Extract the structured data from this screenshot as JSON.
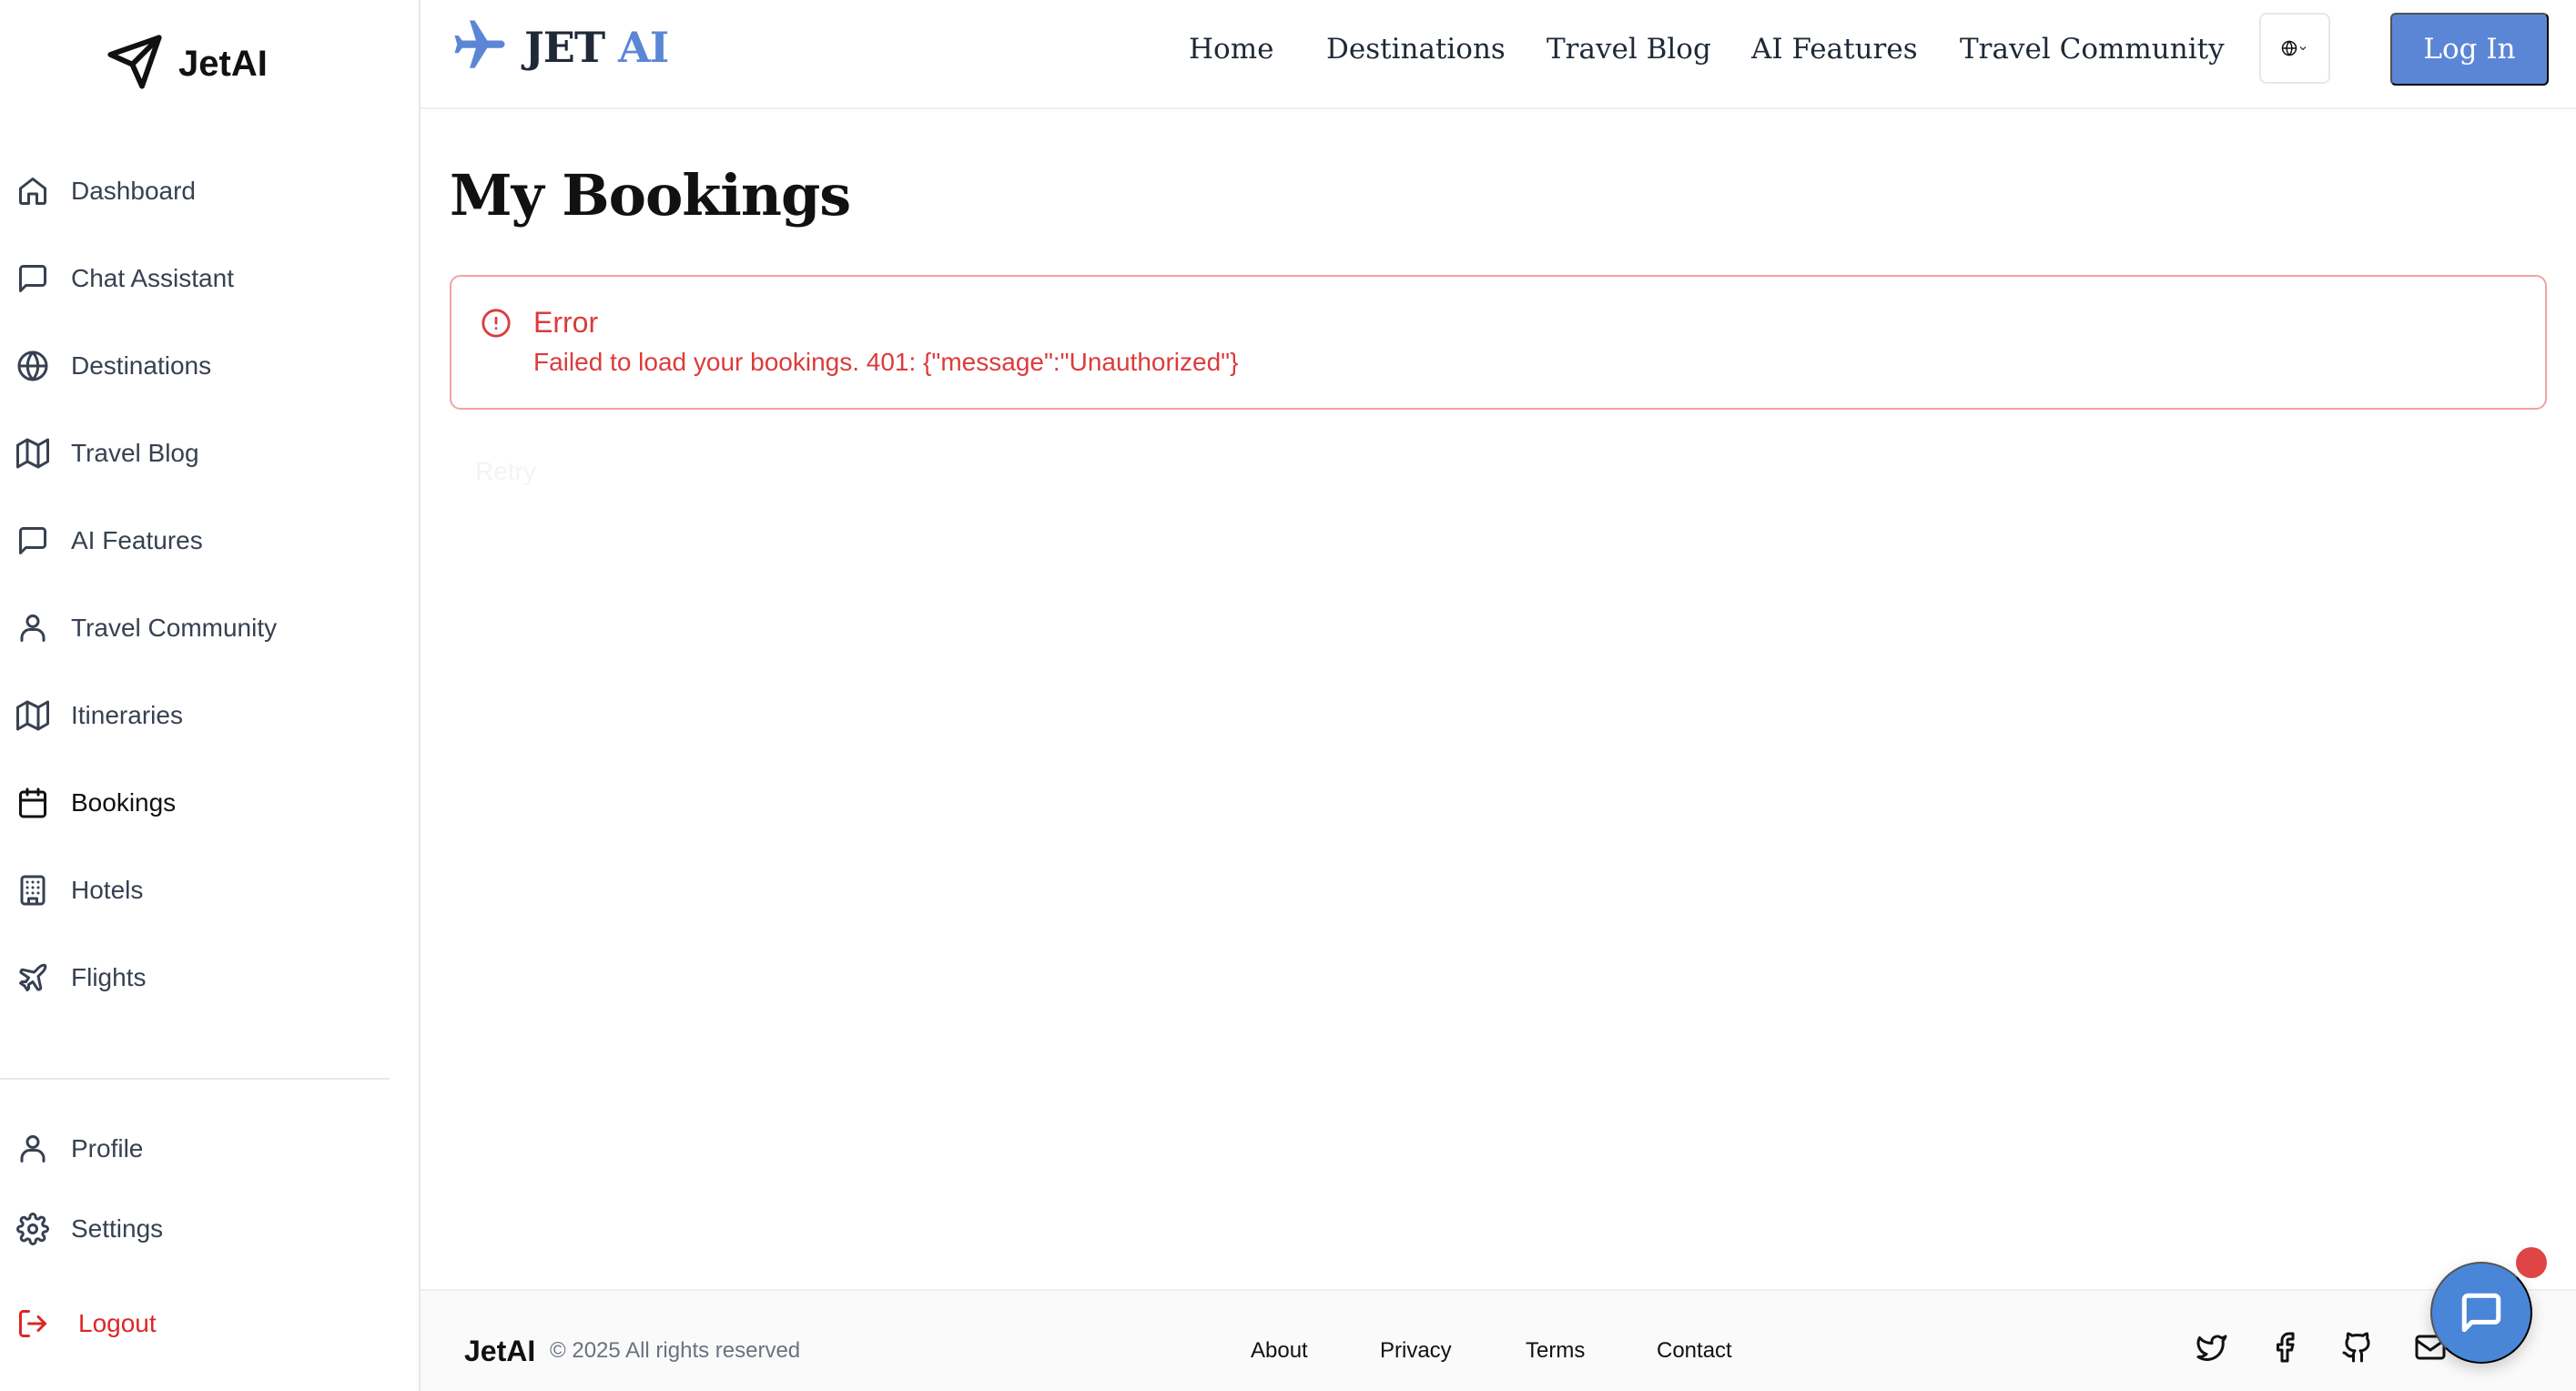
{
  "sidebar": {
    "brand": "JetAI",
    "items": [
      {
        "label": "Dashboard",
        "icon": "home-icon"
      },
      {
        "label": "Chat Assistant",
        "icon": "message-icon"
      },
      {
        "label": "Destinations",
        "icon": "globe-icon"
      },
      {
        "label": "Travel Blog",
        "icon": "map-icon"
      },
      {
        "label": "AI Features",
        "icon": "message-icon"
      },
      {
        "label": "Travel Community",
        "icon": "user-icon"
      },
      {
        "label": "Itineraries",
        "icon": "map-icon"
      },
      {
        "label": "Bookings",
        "icon": "calendar-icon",
        "active": true
      },
      {
        "label": "Hotels",
        "icon": "building-icon"
      },
      {
        "label": "Flights",
        "icon": "plane-icon"
      }
    ],
    "bottom_items": [
      {
        "label": "Profile",
        "icon": "user-icon"
      },
      {
        "label": "Settings",
        "icon": "gear-icon"
      },
      {
        "label": "Logout",
        "icon": "logout-icon"
      }
    ]
  },
  "header": {
    "logo_jet": "JET",
    "logo_ai": "AI",
    "nav": [
      "Home",
      "Destinations",
      "Travel Blog",
      "AI Features",
      "Travel Community"
    ],
    "language_icon": "globe-icon",
    "login_label": "Log In"
  },
  "main": {
    "title": "My Bookings",
    "error": {
      "title": "Error",
      "message": "Failed to load your bookings. 401: {\"message\":\"Unauthorized\"}"
    },
    "faded_text": "Retry"
  },
  "footer": {
    "brand": "JetAI",
    "copyright": "© 2025 All rights reserved",
    "links": [
      "About",
      "Privacy",
      "Terms",
      "Contact"
    ],
    "social": [
      "twitter-icon",
      "facebook-icon",
      "github-icon",
      "mail-icon"
    ]
  },
  "colors": {
    "accent": "#5b86d6",
    "error": "#dc3b3b",
    "chat_button": "#4a86d8",
    "notification": "#e04545"
  }
}
